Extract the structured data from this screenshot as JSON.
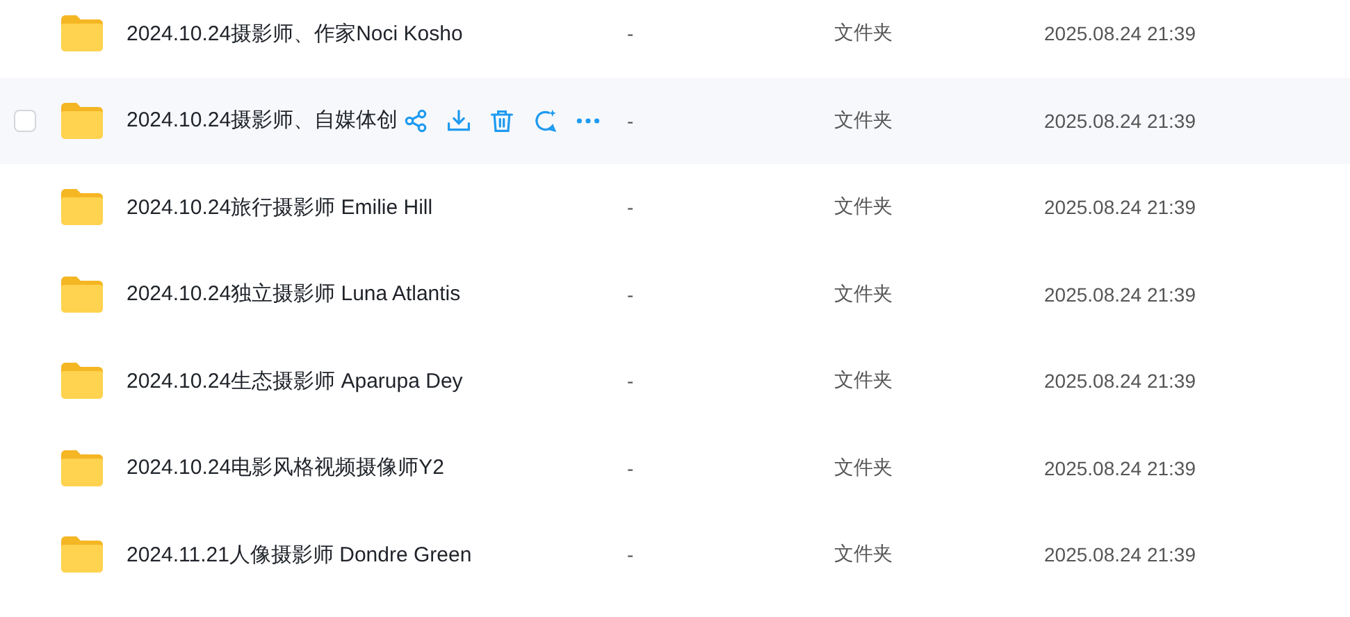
{
  "rows": [
    {
      "name": "2024.10.24摄影师、作家Noci Kosho",
      "size": "-",
      "type": "文件夹",
      "date": "2025.08.24 21:39",
      "hovered": false
    },
    {
      "name": "2024.10.24摄影师、自媒体创",
      "size": "-",
      "type": "文件夹",
      "date": "2025.08.24 21:39",
      "hovered": true,
      "checked": false
    },
    {
      "name": "2024.10.24旅行摄影师 Emilie Hill",
      "size": "-",
      "type": "文件夹",
      "date": "2025.08.24 21:39",
      "hovered": false
    },
    {
      "name": "2024.10.24独立摄影师 Luna Atlantis",
      "size": "-",
      "type": "文件夹",
      "date": "2025.08.24 21:39",
      "hovered": false
    },
    {
      "name": "2024.10.24生态摄影师 Aparupa Dey",
      "size": "-",
      "type": "文件夹",
      "date": "2025.08.24 21:39",
      "hovered": false
    },
    {
      "name": "2024.10.24电影风格视频摄像师Y2",
      "size": "-",
      "type": "文件夹",
      "date": "2025.08.24 21:39",
      "hovered": false
    },
    {
      "name": "2024.11.21人像摄影师 Dondre Green",
      "size": "-",
      "type": "文件夹",
      "date": "2025.08.24 21:39",
      "hovered": false
    }
  ]
}
